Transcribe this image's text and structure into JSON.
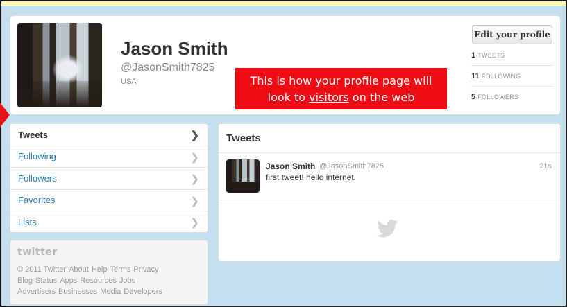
{
  "profile": {
    "name": "Jason Smith",
    "handle": "@JasonSmith7825",
    "location": "USA",
    "edit_button": "Edit your profile",
    "stats": [
      {
        "count": "1",
        "label": "TWEETS"
      },
      {
        "count": "11",
        "label": "FOLLOWING"
      },
      {
        "count": "5",
        "label": "FOLLOWERS"
      }
    ]
  },
  "callout": {
    "line1": "This is how your profile page will",
    "line2_prefix": "look to ",
    "line2_underlined": "visitors",
    "line2_suffix": " on the web",
    "color": "#ef0b14"
  },
  "nav": {
    "items": [
      {
        "label": "Tweets",
        "active": true
      },
      {
        "label": "Following"
      },
      {
        "label": "Followers"
      },
      {
        "label": "Favorites"
      },
      {
        "label": "Lists"
      }
    ]
  },
  "footer": {
    "logo": "twitter",
    "links": [
      "© 2011 Twitter",
      "About",
      "Help",
      "Terms",
      "Privacy",
      "Blog",
      "Status",
      "Apps",
      "Resources",
      "Jobs",
      "Advertisers",
      "Businesses",
      "Media",
      "Developers"
    ]
  },
  "stream": {
    "title": "Tweets",
    "tweets": [
      {
        "name": "Jason Smith",
        "handle": "@JasonSmith7825",
        "time": "21s",
        "text": "first tweet! hello internet."
      }
    ]
  },
  "icons": {
    "chevron": "chevron-right-icon",
    "bird": "twitter-bird-icon"
  },
  "colors": {
    "background": "#c6dfee",
    "link": "#2a80b9",
    "accent_red": "#ef0b14"
  }
}
